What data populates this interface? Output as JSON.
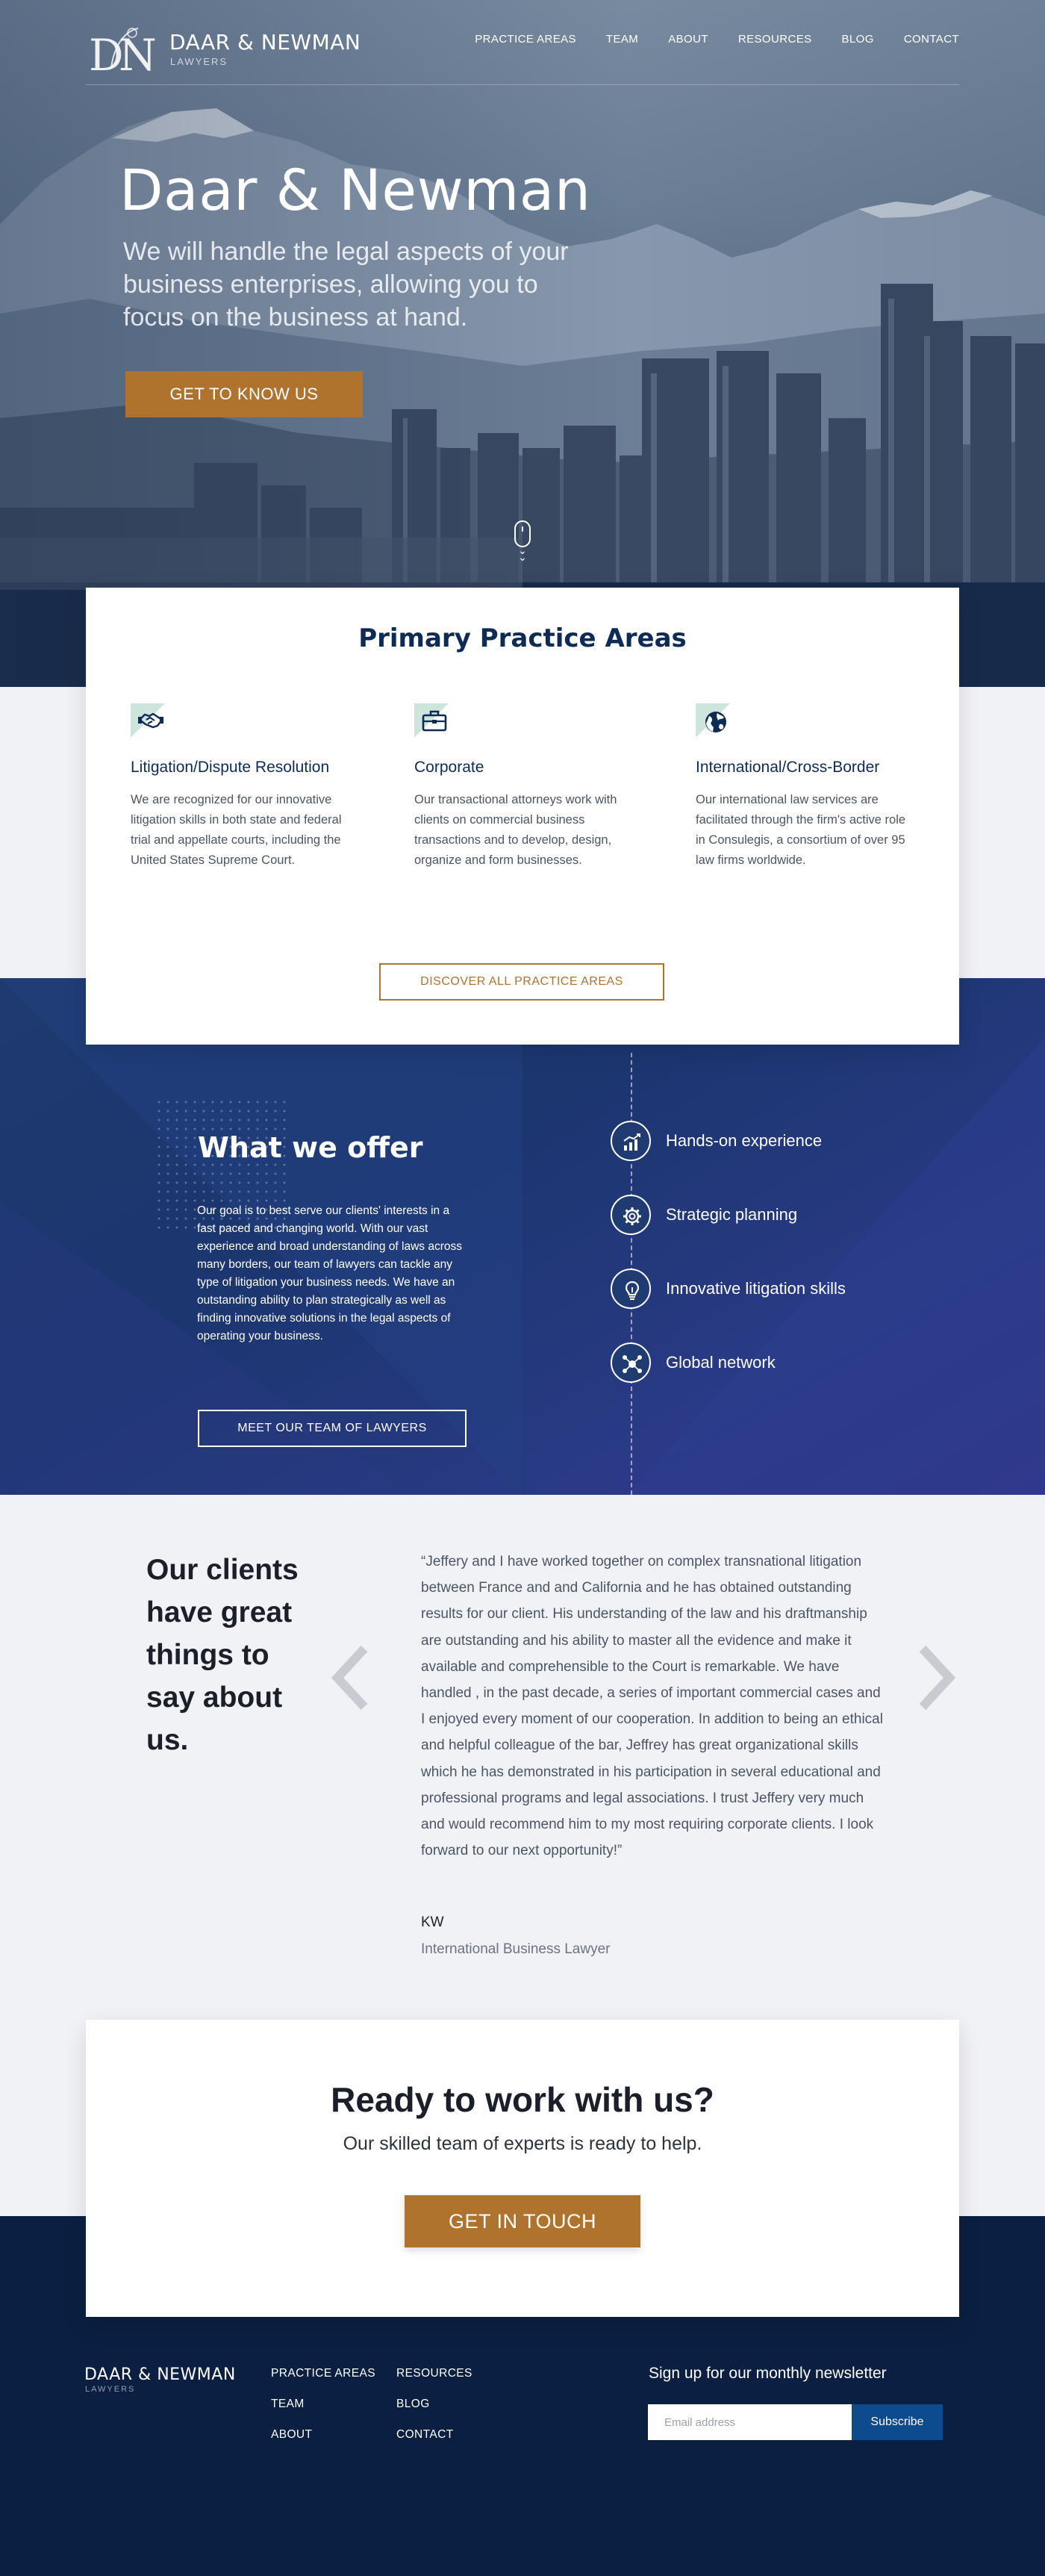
{
  "colors": {
    "brand_navy": "#0e2b56",
    "accent_gold": "#b0732e",
    "offer_bg": "#1e3a6e",
    "footer_bg": "#0a1f42",
    "icon_tint": "#cde5dd",
    "subscribe_blue": "#0e4a8e"
  },
  "header": {
    "logo_initials": "D&N",
    "logo_name": "DAAR & NEWMAN",
    "logo_sub": "LAWYERS",
    "nav": [
      "PRACTICE AREAS",
      "TEAM",
      "ABOUT",
      "RESOURCES",
      "BLOG",
      "CONTACT"
    ]
  },
  "hero": {
    "title": "Daar & Newman",
    "subtitle": "We will handle the legal aspects of your business enterprises, allowing you to focus on the business at hand.",
    "button": "GET TO KNOW  US",
    "scroll_icon": "mouse-scroll-icon"
  },
  "practice": {
    "title": "Primary Practice Areas",
    "areas": [
      {
        "icon": "handshake-icon",
        "title": "Litigation/Dispute Resolution",
        "text": "We are recognized for our innovative litigation skills in both state and federal trial and appellate courts, including the United States Supreme Court."
      },
      {
        "icon": "briefcase-icon",
        "title": "Corporate",
        "text": "Our transactional attorneys work with clients on commercial business transactions and to develop, design, organize and form businesses."
      },
      {
        "icon": "globe-icon",
        "title": "International/Cross-Border",
        "text": "Our international law services are facilitated through the firm's active role in Consulegis, a consortium of over 95 law firms worldwide."
      }
    ],
    "button": "DISCOVER ALL PRACTICE AREAS"
  },
  "offer": {
    "title": "What we offer",
    "text": "Our goal is to best serve our clients' interests in a fast paced and changing world.  With our vast experience and broad understanding of laws across many borders, our team of lawyers can tackle any type of litigation your business needs. We have an outstanding ability to plan strategically as well as finding innovative solutions in the legal aspects of operating your business.",
    "button": "MEET OUR TEAM OF LAWYERS",
    "features": [
      {
        "icon": "chart-growth-icon",
        "label": "Hands-on experience"
      },
      {
        "icon": "gear-icon",
        "label": "Strategic planning"
      },
      {
        "icon": "lightbulb-icon",
        "label": "Innovative litigation skills"
      },
      {
        "icon": "network-icon",
        "label": "Global network"
      }
    ]
  },
  "testimonial": {
    "heading": "Our clients have great things to say about us.",
    "quote": "“Jeffery and I have worked together on complex transnational litigation between France and and California and he has obtained outstanding results for our client. His understanding of the law and his draftmanship are outstanding and his ability to master all the evidence and make it available and comprehensible to the Court is remarkable. We have handled , in the past decade, a series of important commercial cases and I enjoyed every moment of our cooperation. In addition to being an ethical and helpful colleague of the bar, Jeffrey has great organizational skills which he has demonstrated in his participation in several educational and professional programs and legal associations. I trust Jeffery very much and would recommend him to my most requiring corporate clients. I look forward to our next opportunity!”",
    "author": "KW",
    "role": "International Business Lawyer",
    "prev_icon": "chevron-left-icon",
    "next_icon": "chevron-right-icon"
  },
  "cta": {
    "title": "Ready to work with us?",
    "subtitle": "Our skilled team of experts is ready to help.",
    "button": "GET IN TOUCH"
  },
  "footer": {
    "logo_name": "DAAR & NEWMAN",
    "logo_sub": "LAWYERS",
    "col1": [
      "PRACTICE AREAS",
      "TEAM",
      "ABOUT"
    ],
    "col2": [
      "RESOURCES",
      "BLOG",
      "CONTACT"
    ],
    "newsletter_title": "Sign up for our monthly newsletter",
    "email_placeholder": "Email address",
    "subscribe": "Subscribe"
  }
}
